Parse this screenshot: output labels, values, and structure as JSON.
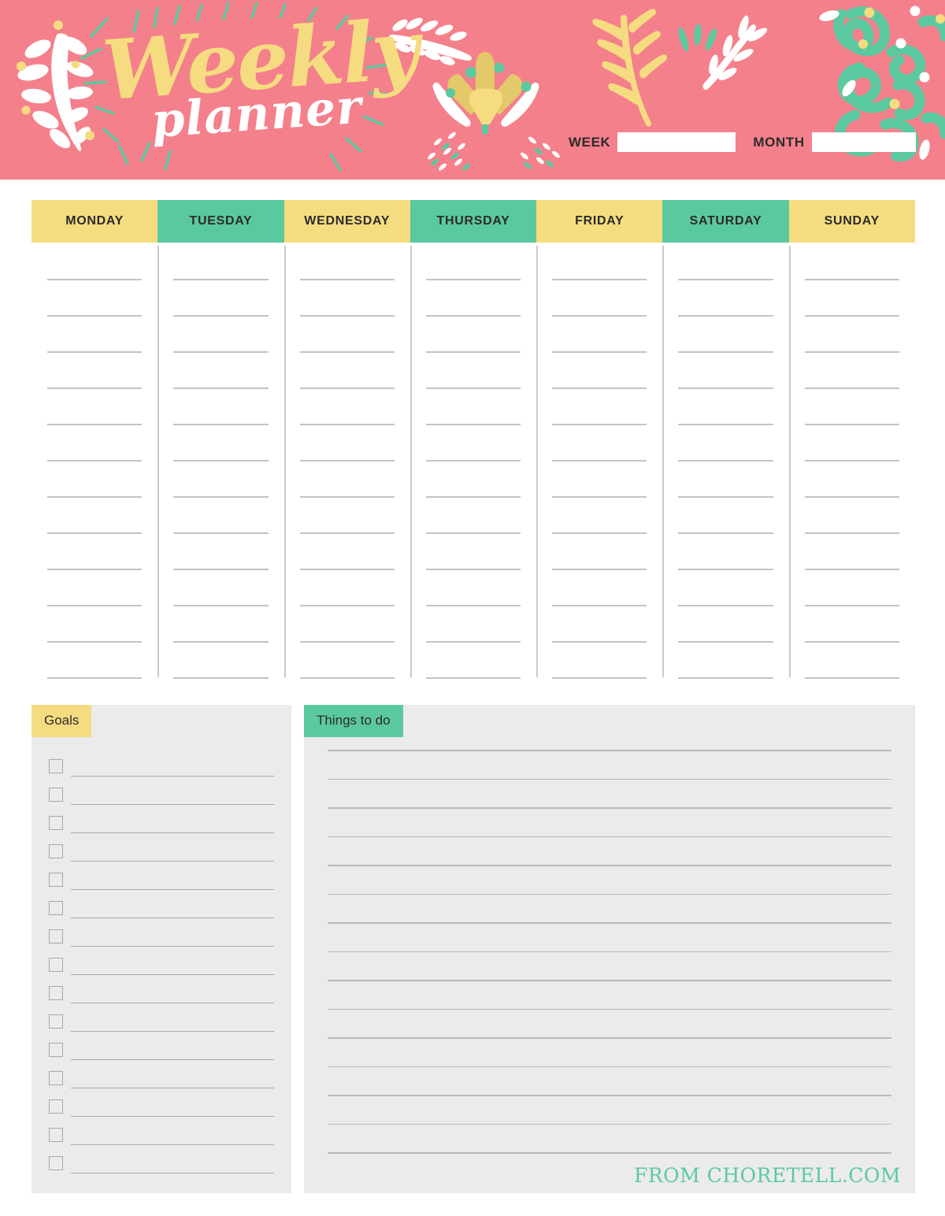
{
  "header": {
    "title_line1": "Weekly",
    "title_line2": "planner",
    "week_label": "WEEK",
    "month_label": "MONTH",
    "week_value": "",
    "month_value": "",
    "background_color": "#F4808C",
    "title_color": "#F5DC80",
    "subtitle_color": "#FFFFFF"
  },
  "days": [
    {
      "label": "MONDAY",
      "tone": "y"
    },
    {
      "label": "TUESDAY",
      "tone": "g"
    },
    {
      "label": "WEDNESDAY",
      "tone": "y"
    },
    {
      "label": "THURSDAY",
      "tone": "g"
    },
    {
      "label": "FRIDAY",
      "tone": "y"
    },
    {
      "label": "SATURDAY",
      "tone": "g"
    },
    {
      "label": "SUNDAY",
      "tone": "y"
    }
  ],
  "day_line_count": 12,
  "goals": {
    "tab_label": "Goals",
    "tab_color": "#F5DC80",
    "checkbox_count": 15,
    "items": [
      "",
      "",
      "",
      "",
      "",
      "",
      "",
      "",
      "",
      "",
      "",
      "",
      "",
      "",
      ""
    ]
  },
  "things_to_do": {
    "tab_label": "Things to do",
    "tab_color": "#5BC99F",
    "line_count": 15,
    "items": [
      "",
      "",
      "",
      "",
      "",
      "",
      "",
      "",
      "",
      "",
      "",
      "",
      "",
      "",
      ""
    ]
  },
  "footer": {
    "credit": "FROM CHORETELL.COM",
    "credit_color": "#5BC99F"
  },
  "palette": {
    "pink": "#F4808C",
    "yellow": "#F5DC80",
    "green": "#5BC99F",
    "panel_gray": "#EBEBEB",
    "rule_gray": "#C4C4C4"
  }
}
